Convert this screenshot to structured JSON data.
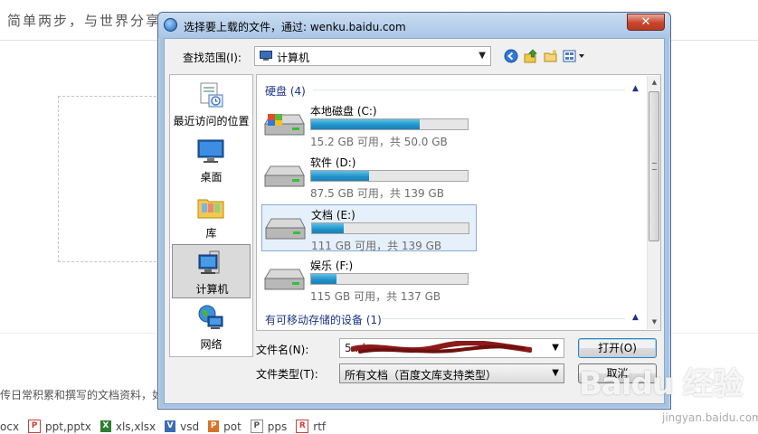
{
  "background": {
    "slogan": "简单两步，与世界分享",
    "description": "传日常积累和撰写的文档资料，如",
    "file_types": [
      {
        "icon": "ppt-icon",
        "badge": "P",
        "label": "ppt,pptx"
      },
      {
        "icon": "excel-icon",
        "badge": "X",
        "label": "xls,xlsx"
      },
      {
        "icon": "visio-icon",
        "badge": "V",
        "label": "vsd"
      },
      {
        "icon": "pot-icon",
        "badge": "P",
        "label": "pot"
      },
      {
        "icon": "pps-icon",
        "badge": "P",
        "label": "pps"
      },
      {
        "icon": "rtf-icon",
        "badge": "R",
        "label": "rtf"
      }
    ],
    "file_type_partial": "ocx"
  },
  "dialog": {
    "title": "选择要上载的文件，通过: wenku.baidu.com",
    "close_label": "✕",
    "lookin_label": "查找范围(I):",
    "lookin_value": "计算机",
    "places": [
      {
        "label": "最近访问的位置",
        "icon": "recent-places-icon"
      },
      {
        "label": "桌面",
        "icon": "desktop-icon"
      },
      {
        "label": "库",
        "icon": "libraries-icon"
      },
      {
        "label": "计算机",
        "icon": "computer-icon"
      },
      {
        "label": "网络",
        "icon": "network-icon"
      }
    ],
    "groups": {
      "hard_disks": "硬盘 (4)",
      "removable": "有可移动存储的设备 (1)"
    },
    "drives": [
      {
        "name": "本地磁盘 (C:)",
        "size": "15.2 GB 可用，共 50.0 GB",
        "used_fraction": 0.696
      },
      {
        "name": "软件 (D:)",
        "size": "87.5 GB 可用，共 139 GB",
        "used_fraction": 0.37
      },
      {
        "name": "文档 (E:)",
        "size": "111 GB 可用，共 139 GB",
        "used_fraction": 0.2
      },
      {
        "name": "娱乐 (F:)",
        "size": "115 GB 可用，共 137 GB",
        "used_fraction": 0.16
      }
    ],
    "filename_label": "文件名(N):",
    "filename_value": "5                                          .d",
    "filetype_label": "文件类型(T):",
    "filetype_value": "所有文档（百度文库支持类型）",
    "open_button": "打开(O)",
    "cancel_button": "取消"
  },
  "watermark": {
    "logo": "Baidu 经验",
    "url": "jingyan.baidu.com"
  }
}
